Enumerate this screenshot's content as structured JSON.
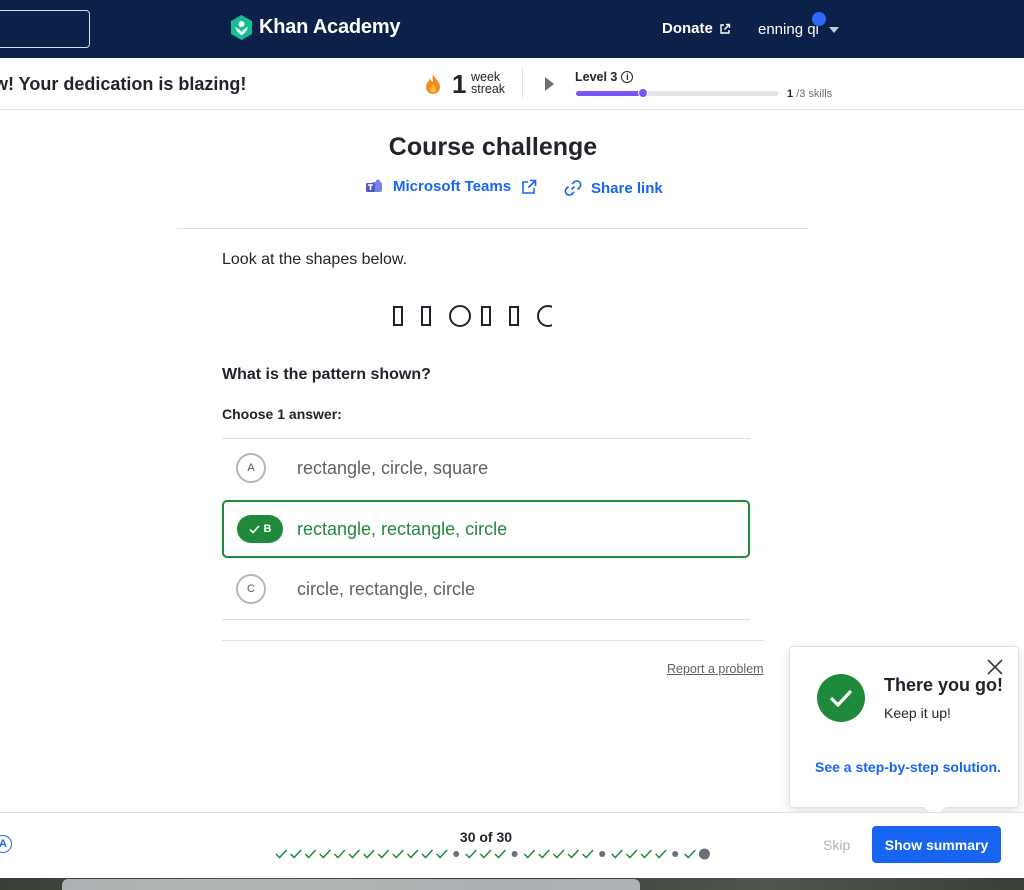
{
  "header": {
    "brand": "Khan Academy",
    "donate_label": "Donate",
    "user_name": "enning qi"
  },
  "streak_bar": {
    "dedication_text": "w! Your dedication is blazing!",
    "streak_count": "1",
    "streak_unit_1": "week",
    "streak_unit_2": "streak",
    "level_label": "Level 3",
    "level_progress": 0.33,
    "skills_done": "1",
    "skills_total": "/3 skills"
  },
  "challenge": {
    "title": "Course challenge",
    "teams_label": "Microsoft Teams",
    "share_label": "Share link"
  },
  "question": {
    "prompt": "Look at the shapes below.",
    "shape_sequence": [
      "rectangle",
      "rectangle",
      "circle",
      "rectangle",
      "rectangle",
      "circle"
    ],
    "text": "What is the pattern shown?",
    "choose_label": "Choose 1 answer:",
    "choices": [
      {
        "letter": "A",
        "text": "rectangle, circle, square",
        "state": "unselected"
      },
      {
        "letter": "B",
        "text": "rectangle, rectangle, circle",
        "state": "correct"
      },
      {
        "letter": "C",
        "text": "circle, rectangle, circle",
        "state": "unselected"
      }
    ],
    "report_label": "Report a problem"
  },
  "feedback": {
    "title": "There you go!",
    "subtitle": "Keep it up!",
    "link": "See a step-by-step solution."
  },
  "footer": {
    "progress_text": "30 of 30",
    "marks": [
      "check",
      "check",
      "check",
      "check",
      "check",
      "check",
      "check",
      "check",
      "check",
      "check",
      "check",
      "check",
      "dot",
      "check",
      "check",
      "check",
      "dot",
      "check",
      "check",
      "check",
      "check",
      "check",
      "dot",
      "check",
      "check",
      "check",
      "check",
      "dot",
      "check",
      "current"
    ],
    "skip_label": "Skip",
    "summary_label": "Show summary"
  },
  "colors": {
    "header_bg": "#0b2149",
    "accent_blue": "#1865f2",
    "correct_green": "#1f8a3b",
    "level_purple": "#7854f7"
  }
}
